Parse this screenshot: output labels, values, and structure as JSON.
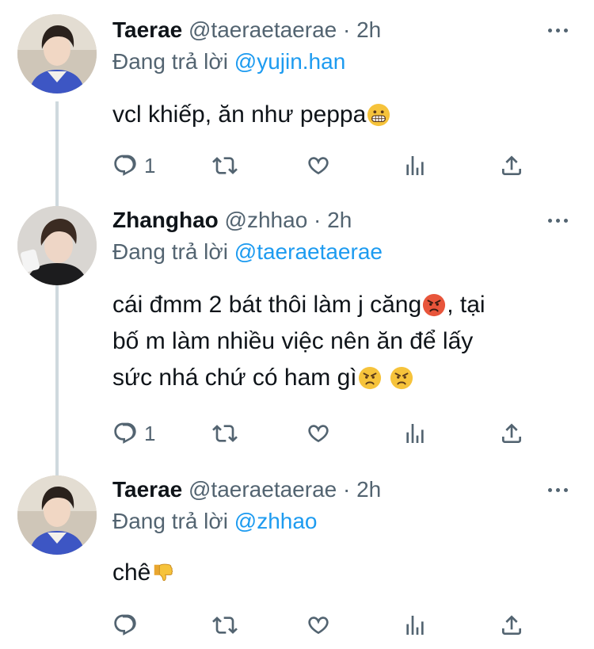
{
  "tweets": [
    {
      "name": "Taerae",
      "handle": "@taeraetaerae",
      "separator": "·",
      "time": "2h",
      "replying_prefix": "Đang trả lời",
      "replying_to": "@yujin.han",
      "text_before": "vcl khiếp, ăn như peppa",
      "emojis": [
        "grimacing-emoji"
      ],
      "reply_count": "1"
    },
    {
      "name": "Zhanghao",
      "handle": "@zhhao",
      "separator": "·",
      "time": "2h",
      "replying_prefix": "Đang trả lời",
      "replying_to": "@taeraetaerae",
      "text_line1": "cái đmm 2 bát thôi làm j căng",
      "text_line1_after": ", tại",
      "text_line2": "bố m làm nhiều việc nên ăn để lấy",
      "text_line3": "sức nhá chứ có ham gì",
      "reply_count": "1"
    },
    {
      "name": "Taerae",
      "handle": "@taeraetaerae",
      "separator": "·",
      "time": "2h",
      "replying_prefix": "Đang trả lời",
      "replying_to": "@zhhao",
      "text_before": "chê",
      "reply_count": ""
    }
  ],
  "colors": {
    "mention": "#1d9bf0",
    "secondary": "#536471",
    "text": "#0f1419",
    "thread_line": "#cfd9de"
  }
}
